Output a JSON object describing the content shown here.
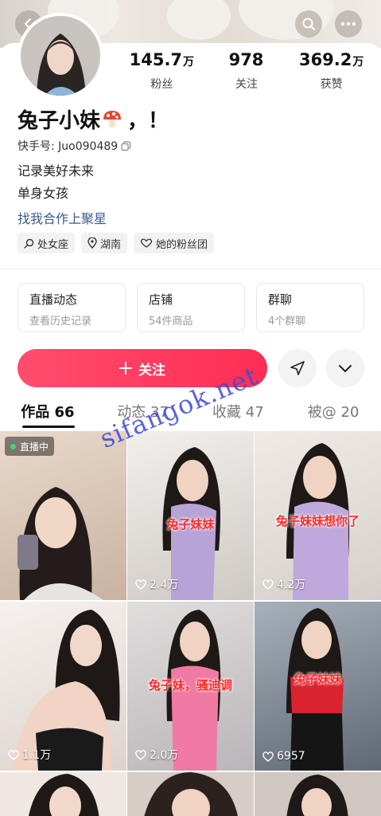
{
  "profile": {
    "name": "兔子小妹",
    "name_suffix": "，！",
    "uid": "快手号: Juo090489",
    "bio_line1": "记录美好未来",
    "bio_line2": "单身女孩",
    "collab_link": "找我合作上聚星",
    "tags": [
      {
        "icon": "search-icon",
        "label": "处女座"
      },
      {
        "icon": "location-icon",
        "label": "湖南"
      },
      {
        "icon": "fan-club-icon",
        "label": "她的粉丝团"
      }
    ]
  },
  "stats": [
    {
      "value": "145.7",
      "unit": "万",
      "label": "粉丝"
    },
    {
      "value": "978",
      "unit": "",
      "label": "关注"
    },
    {
      "value": "369.2",
      "unit": "万",
      "label": "获赞"
    }
  ],
  "cards": [
    {
      "title": "直播动态",
      "subtitle": "查看历史记录"
    },
    {
      "title": "店铺",
      "subtitle": "54件商品"
    },
    {
      "title": "群聊",
      "subtitle": "4个群聊"
    }
  ],
  "follow_button": {
    "label": "关注",
    "icon": "plus-icon"
  },
  "tabs": [
    {
      "label": "作品 66",
      "active": true
    },
    {
      "label": "动态 37",
      "active": false
    },
    {
      "label": "收藏 47",
      "active": false
    },
    {
      "label": "被@ 20",
      "active": false
    }
  ],
  "grid": [
    {
      "live_badge": "直播中",
      "likes": "",
      "caption": ""
    },
    {
      "live_badge": "",
      "likes": "2.4万",
      "caption": "兔子妹妹"
    },
    {
      "live_badge": "",
      "likes": "4.2万",
      "caption": "兔子妹妹想你了"
    },
    {
      "live_badge": "",
      "likes": "1.1万",
      "caption": ""
    },
    {
      "live_badge": "",
      "likes": "2.0万",
      "caption": "兔子妹，骚迪调"
    },
    {
      "live_badge": "",
      "likes": "6957",
      "caption": "兔子妹妹"
    }
  ],
  "watermark": "sifangok.net",
  "colors": {
    "accent": "#ff2d55",
    "link": "#3b5a8f",
    "live_dot": "#3ad97a",
    "caption_red": "#ff2a2a",
    "watermark": "#3a49d8"
  }
}
